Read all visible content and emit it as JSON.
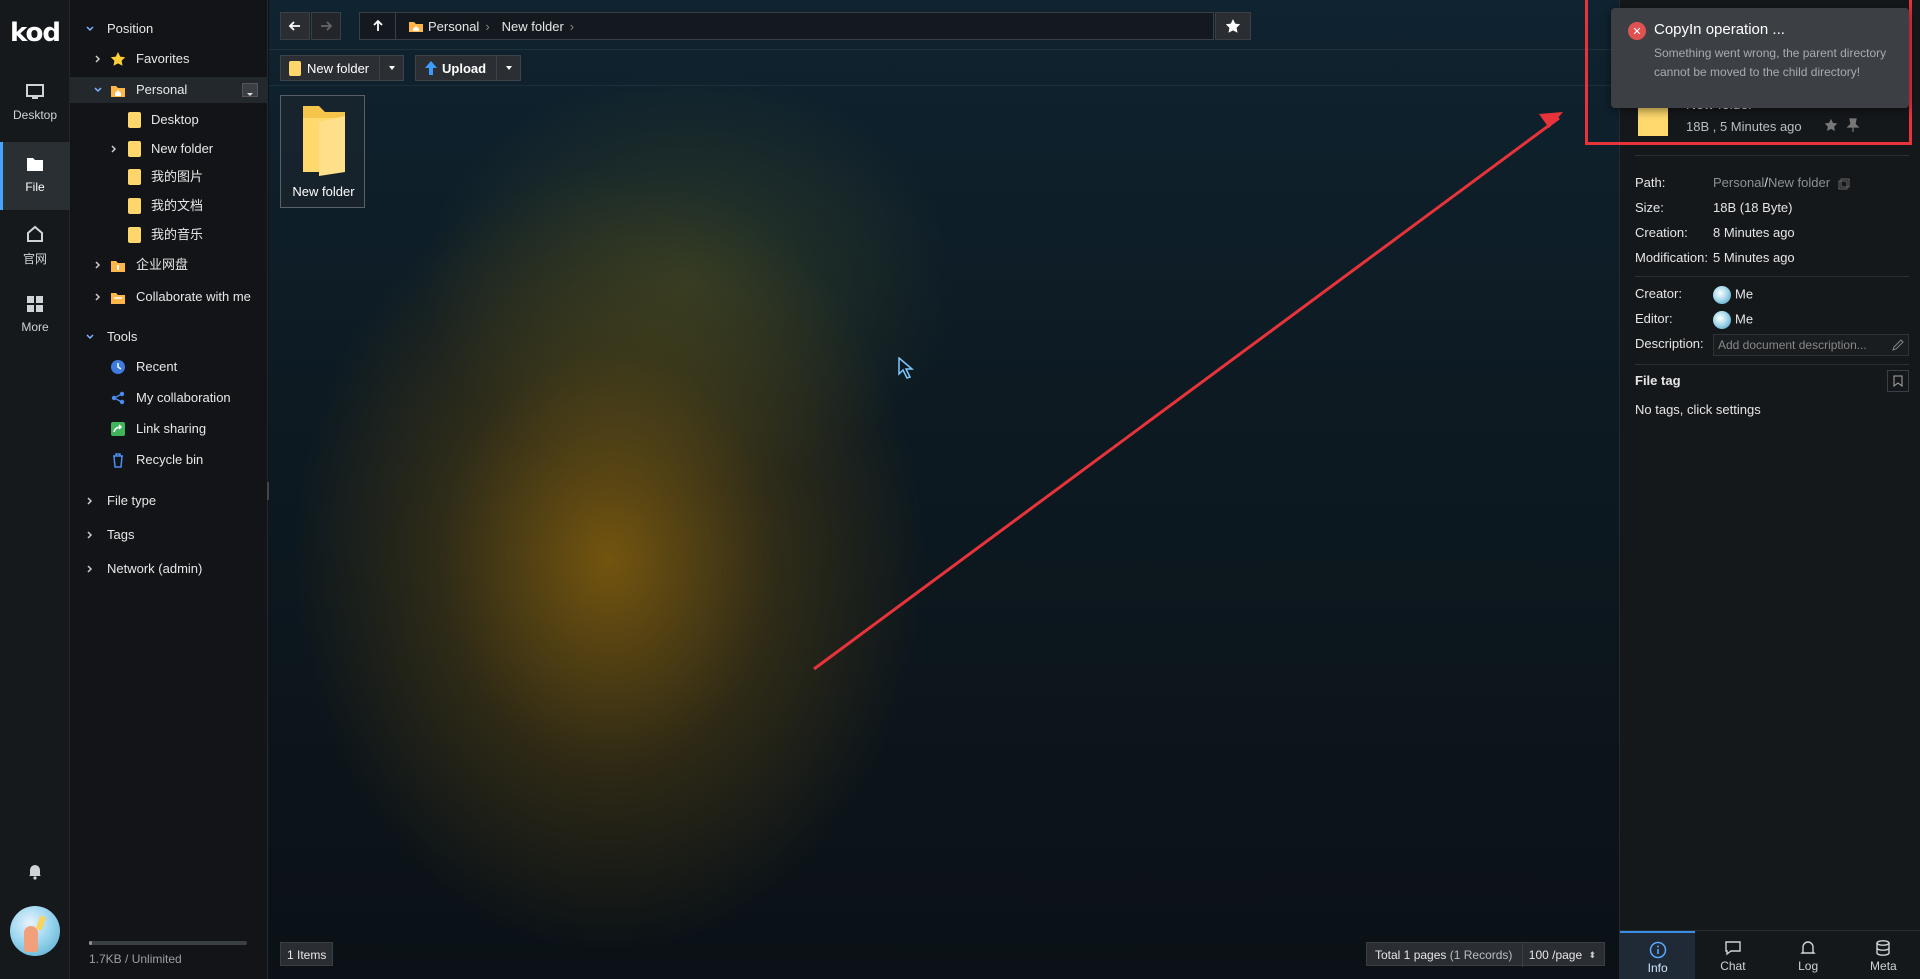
{
  "app": {
    "logo": "kod"
  },
  "rail": {
    "items": [
      {
        "label": "Desktop",
        "icon": "monitor-icon"
      },
      {
        "label": "File",
        "icon": "folder-icon",
        "active": true
      },
      {
        "label": "官网",
        "icon": "home-icon"
      },
      {
        "label": "More",
        "icon": "grid-icon"
      }
    ],
    "bell_icon": "bell-icon",
    "avatar": "user-avatar"
  },
  "tree": {
    "position_label": "Position",
    "favorites_label": "Favorites",
    "personal_label": "Personal",
    "personal_children": [
      "Desktop",
      "New folder",
      "我的图片",
      "我的文档",
      "我的音乐"
    ],
    "enterprise_label": "企业网盘",
    "collab_label": "Collaborate with me",
    "tools_label": "Tools",
    "tools": [
      "Recent",
      "My collaboration",
      "Link sharing",
      "Recycle bin"
    ],
    "file_type_label": "File type",
    "tags_label": "Tags",
    "network_label": "Network (admin)",
    "quota_text": "1.7KB / Unlimited",
    "quota_fraction": 0.02
  },
  "main": {
    "breadcrumb": [
      "Personal",
      "New folder"
    ],
    "toolbar": {
      "new_folder": "New folder",
      "upload": "Upload"
    },
    "files": [
      {
        "name": "New folder"
      }
    ],
    "status": {
      "items": "1 Items",
      "total_pages": "Total 1 pages",
      "records": "(1 Records)",
      "per_page": "100 /page"
    }
  },
  "info": {
    "name": "New folder",
    "meta": "18B , 5 Minutes ago",
    "path_label": "Path:",
    "path_root": "Personal",
    "path_sep": "/",
    "path_leaf": "New folder",
    "size_label": "Size:",
    "size_value": "18B (18 Byte)",
    "creation_label": "Creation:",
    "creation_value": "8 Minutes ago",
    "modification_label": "Modification:",
    "modification_value": "5 Minutes ago",
    "creator_label": "Creator:",
    "creator_value": "Me",
    "editor_label": "Editor:",
    "editor_value": "Me",
    "description_label": "Description:",
    "description_placeholder": "Add document description...",
    "file_tag_label": "File tag",
    "no_tags": "No tags, click settings",
    "tabs": [
      "Info",
      "Chat",
      "Log",
      "Meta"
    ]
  },
  "toast": {
    "title": "CopyIn operation ...",
    "message": "Something went wrong, the parent directory cannot be moved to the child directory!"
  },
  "colors": {
    "accent": "#4aa3ff",
    "error": "#e05252",
    "highlight": "#e8333a",
    "folder": "#ffd66b"
  }
}
